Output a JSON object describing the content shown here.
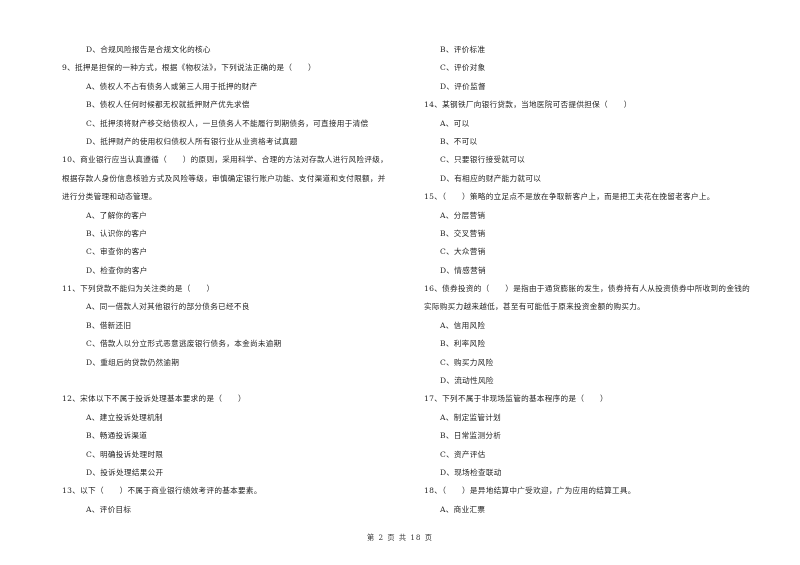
{
  "left_column": [
    {
      "type": "opt",
      "text": "D、合规风险报告是合规文化的核心"
    },
    {
      "type": "q",
      "text": "9、抵押是担保的一种方式，根据《物权法》，下列说法正确的是（　　）"
    },
    {
      "type": "opt",
      "text": "A、债权人不占有债务人或第三人用于抵押的财产"
    },
    {
      "type": "opt",
      "text": "B、债权人任何时候都无权就抵押财产优先求偿"
    },
    {
      "type": "opt",
      "text": "C、抵押须将财产移交给债权人，一旦债务人不能履行到期债务，可直接用于清偿"
    },
    {
      "type": "opt",
      "text": "D、抵押财产的使用权归债权人所有银行业从业资格考试真题"
    },
    {
      "type": "q",
      "text": "10、商业银行应当认真遵循（　　）的原则，采用科学、合理的方法对存款人进行风险评级，"
    },
    {
      "type": "q",
      "text": "根据存款人身份信息核验方式及风险等级，审慎确定银行账户功能、支付渠道和支付限额，并"
    },
    {
      "type": "q",
      "text": "进行分类管理和动态管理。"
    },
    {
      "type": "opt",
      "text": "A、了解你的客户"
    },
    {
      "type": "opt",
      "text": "B、认识你的客户"
    },
    {
      "type": "opt",
      "text": "C、审查你的客户"
    },
    {
      "type": "opt",
      "text": "D、检查你的客户"
    },
    {
      "type": "q",
      "text": "11、下列贷款不能归为关注类的是（　　）"
    },
    {
      "type": "opt",
      "text": "A、同一借款人对其他银行的部分债务已经不良"
    },
    {
      "type": "opt",
      "text": "B、借新还旧"
    },
    {
      "type": "opt",
      "text": "C、借款人以分立形式恶意逃废银行债务，本金尚未逾期"
    },
    {
      "type": "opt",
      "text": "D、重组后的贷款仍然逾期"
    },
    {
      "type": "blank",
      "text": ""
    },
    {
      "type": "q",
      "text": "12、宋体以下不属于投诉处理基本要求的是（　　）"
    },
    {
      "type": "opt",
      "text": "A、建立投诉处理机制"
    },
    {
      "type": "opt",
      "text": "B、畅通投诉渠道"
    },
    {
      "type": "opt",
      "text": "C、明确投诉处理时限"
    },
    {
      "type": "opt",
      "text": "D、投诉处理结果公开"
    },
    {
      "type": "q",
      "text": "13、以下（　　）不属于商业银行绩效考评的基本要素。"
    },
    {
      "type": "opt",
      "text": "A、评价目标"
    }
  ],
  "right_column": [
    {
      "type": "opt",
      "text": "B、评价标准"
    },
    {
      "type": "opt",
      "text": "C、评价对象"
    },
    {
      "type": "opt",
      "text": "D、评价监督"
    },
    {
      "type": "q",
      "text": "14、某钢铁厂向银行贷款，当地医院可否提供担保（　　）"
    },
    {
      "type": "opt",
      "text": "A、可以"
    },
    {
      "type": "opt",
      "text": "B、不可以"
    },
    {
      "type": "opt",
      "text": "C、只要银行接受就可以"
    },
    {
      "type": "opt",
      "text": "D、有相应的财产能力就可以"
    },
    {
      "type": "q",
      "text": "15、（　　）策略的立足点不是放在争取新客户上，而是把工夫花在挽留老客户上。"
    },
    {
      "type": "opt",
      "text": "A、分层营销"
    },
    {
      "type": "opt",
      "text": "B、交叉营销"
    },
    {
      "type": "opt",
      "text": "C、大众营销"
    },
    {
      "type": "opt",
      "text": "D、情感营销"
    },
    {
      "type": "q",
      "text": "16、债券投资的（　　）是指由于通货膨胀的发生，债券持有人从投资债券中所收到的金钱的"
    },
    {
      "type": "q",
      "text": "实际购买力越来越低，甚至有可能低于原来投资金额的购买力。"
    },
    {
      "type": "opt",
      "text": "A、信用风险"
    },
    {
      "type": "opt",
      "text": "B、利率风险"
    },
    {
      "type": "opt",
      "text": "C、购买力风险"
    },
    {
      "type": "opt",
      "text": "D、流动性风险"
    },
    {
      "type": "q",
      "text": "17、下列不属于非现场监管的基本程序的是（　　）"
    },
    {
      "type": "opt",
      "text": "A、制定监管计划"
    },
    {
      "type": "opt",
      "text": "B、日常监测分析"
    },
    {
      "type": "opt",
      "text": "C、资产评估"
    },
    {
      "type": "opt",
      "text": "D、现场检查联动"
    },
    {
      "type": "q",
      "text": "18、（　　）是异地结算中广受欢迎，广为应用的结算工具。"
    },
    {
      "type": "opt",
      "text": "A、商业汇票"
    }
  ],
  "footer": {
    "page_label": "第 2 页 共 18 页"
  }
}
